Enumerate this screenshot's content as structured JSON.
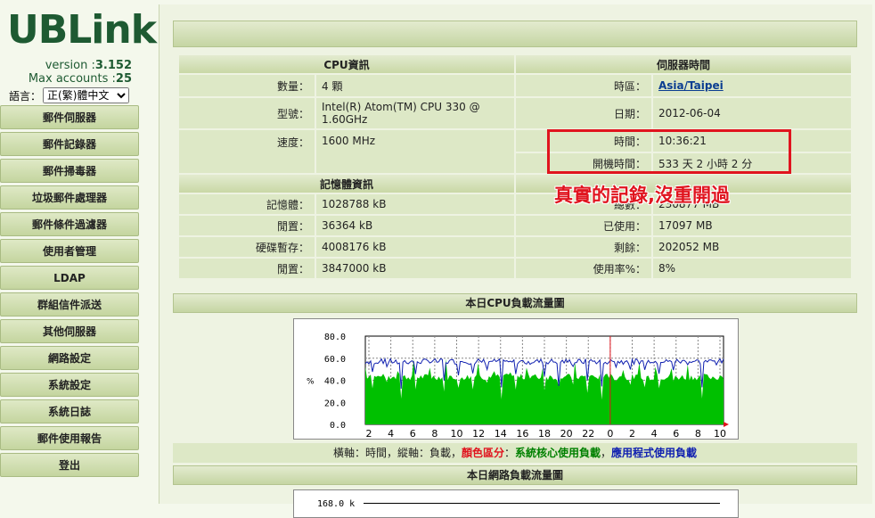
{
  "brand": {
    "logo": "UBLink",
    "version_label": "version :",
    "version": "3.152",
    "accounts_label": "Max accounts :",
    "accounts": "25"
  },
  "language": {
    "label": "語言：",
    "selected": "正(繁)體中文"
  },
  "menu": [
    "郵件伺服器",
    "郵件記錄器",
    "郵件掃毒器",
    "垃圾郵件處理器",
    "郵件條件過濾器",
    "使用者管理",
    "LDAP",
    "群組信件派送",
    "其他伺服器",
    "網路設定",
    "系統設定",
    "系統日誌",
    "郵件使用報告",
    "登出"
  ],
  "cpu": {
    "title": "CPU資訊",
    "rows": [
      {
        "label": "數量：",
        "value": "4 顆"
      },
      {
        "label": "型號：",
        "value": "Intel(R) Atom(TM) CPU 330 @ 1.60GHz"
      },
      {
        "label": "速度：",
        "value": "1600 MHz"
      }
    ]
  },
  "server_time": {
    "title": "伺服器時間",
    "rows": [
      {
        "label": "時區：",
        "value": "Asia/Taipei"
      },
      {
        "label": "日期：",
        "value": "2012-06-04"
      },
      {
        "label": "時間：",
        "value": "10:36:21"
      },
      {
        "label": "開機時間：",
        "value": "533 天 2 小時 2 分"
      }
    ]
  },
  "memory": {
    "title": "記憶體資訊",
    "rows": [
      {
        "label": "記憶體：",
        "value": "1028788 kB"
      },
      {
        "label": "閒置：",
        "value": "36364 kB"
      },
      {
        "label": "硬碟暫存：",
        "value": "4008176 kB"
      },
      {
        "label": "閒置：",
        "value": "3847000 kB"
      }
    ]
  },
  "disk": {
    "rows": [
      {
        "label": "總數：",
        "value": "230877 MB"
      },
      {
        "label": "已使用：",
        "value": "17097 MB"
      },
      {
        "label": "剩餘：",
        "value": "202052 MB"
      },
      {
        "label": "使用率%：",
        "value": "8%"
      }
    ]
  },
  "cpu_chart_title": "本日CPU負載流量圖",
  "legend": {
    "part1": "橫軸：時間，縱軸：負載，",
    "part2": "顏色區分",
    "part3": "：",
    "part4": "系統核心使用負載",
    "part5": "，",
    "part6": "應用程式使用負載"
  },
  "net_chart_title": "本日網路負載流量圖",
  "net_chart_first_tick": "168.0 k",
  "annotation": "真實的記錄,沒重開過",
  "colors": {
    "green": "#00c000",
    "blue": "#1020b0",
    "red": "#e0141e"
  },
  "chart_data": {
    "type": "area",
    "ylabel": "%",
    "ylim": [
      0,
      80
    ],
    "yticks": [
      "0.0",
      "20.0",
      "40.0",
      "60.0",
      "80.0"
    ],
    "xticks": [
      "2",
      "4",
      "6",
      "8",
      "10",
      "12",
      "14",
      "16",
      "18",
      "20",
      "22",
      "0",
      "2",
      "4",
      "6",
      "8",
      "10"
    ],
    "series": [
      {
        "name": "系統核心使用負載",
        "color": "#00c000",
        "typical": 43
      },
      {
        "name": "應用程式使用負載",
        "color": "#1020b0",
        "typical": 57
      }
    ]
  }
}
